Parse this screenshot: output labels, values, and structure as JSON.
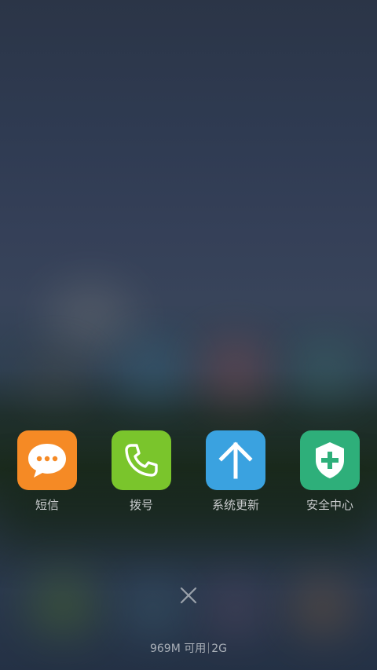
{
  "recent_apps": [
    {
      "label": "短信",
      "icon": "message-icon",
      "color": "#f58a25"
    },
    {
      "label": "拨号",
      "icon": "phone-icon",
      "color": "#7ac52c"
    },
    {
      "label": "系统更新",
      "icon": "arrow-up-icon",
      "color": "#3aa2e0"
    },
    {
      "label": "安全中心",
      "icon": "shield-plus-icon",
      "color": "#2eaf7a"
    }
  ],
  "close_all": {
    "icon": "close-icon"
  },
  "memory": {
    "available": "969M 可用",
    "total": "2G"
  }
}
